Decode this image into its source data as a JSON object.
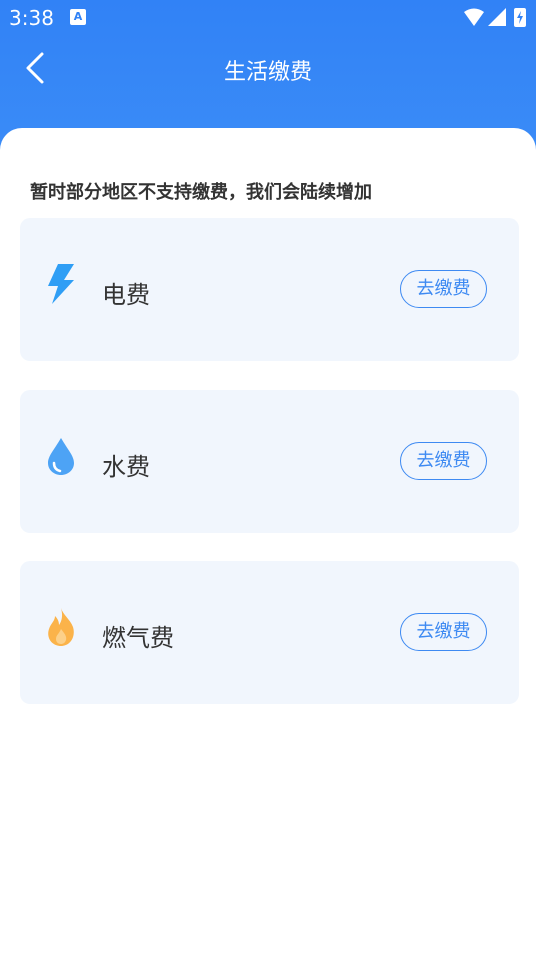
{
  "status_bar": {
    "time": "3:38",
    "notification_badge": "A"
  },
  "nav": {
    "title": "生活缴费"
  },
  "notice": "暂时部分地区不支持缴费，我们会陆续增加",
  "items": [
    {
      "label": "电费",
      "button": "去缴费",
      "icon": "lightning-icon",
      "icon_color": "#2f9ef5"
    },
    {
      "label": "水费",
      "button": "去缴费",
      "icon": "water-drop-icon",
      "icon_color": "#4da3f5"
    },
    {
      "label": "燃气费",
      "button": "去缴费",
      "icon": "flame-icon",
      "icon_color": "#fbb34a"
    }
  ],
  "colors": {
    "header": "#3182f6",
    "card_bg": "#f1f6fd",
    "button_accent": "#3e8af2"
  }
}
